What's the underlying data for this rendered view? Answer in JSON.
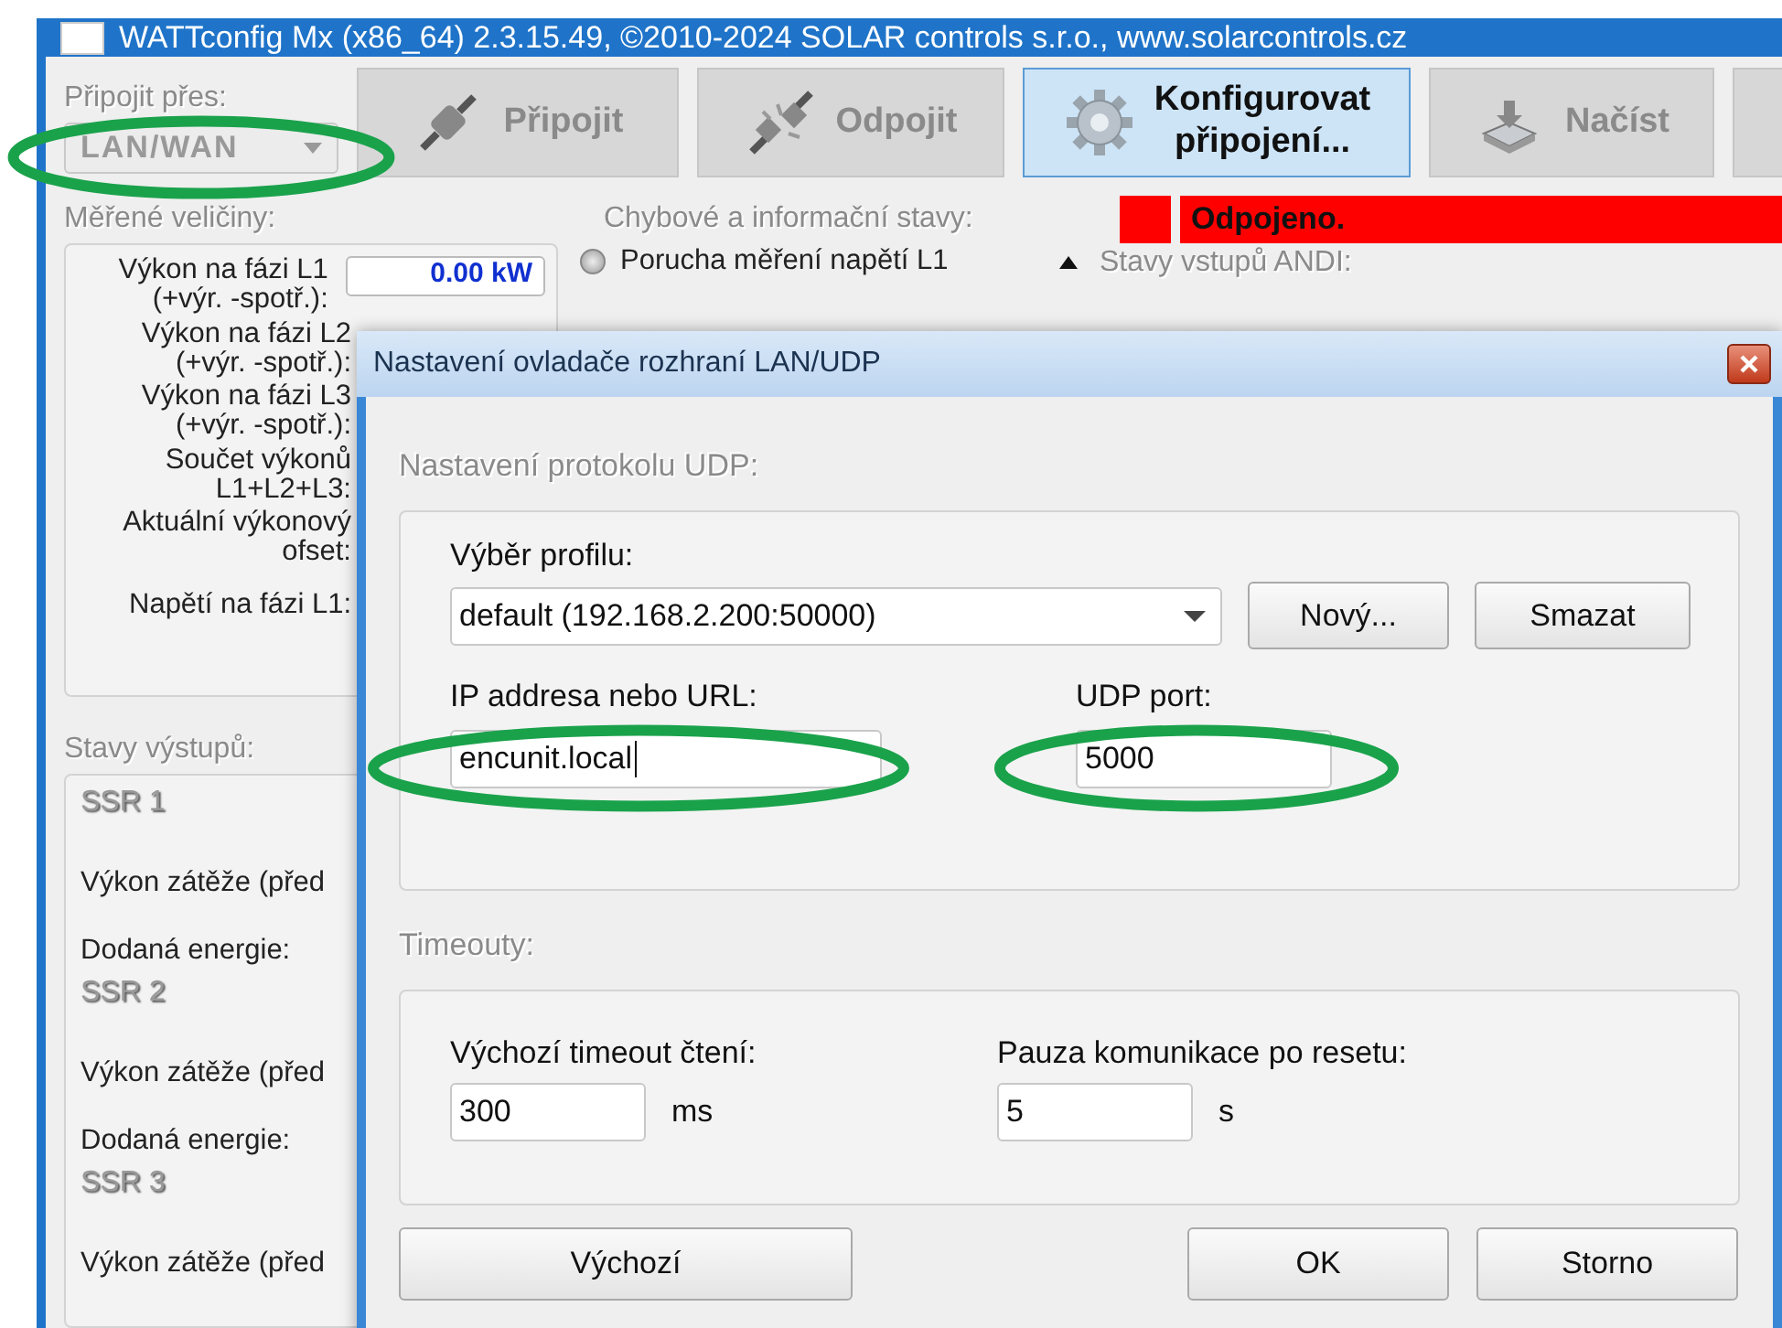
{
  "window": {
    "title": "WATTconfig Mx (x86_64) 2.3.15.49, ©2010-2024 SOLAR controls s.r.o., www.solarcontrols.cz"
  },
  "connection": {
    "label": "Připojit přes:",
    "value": "LAN/WAN",
    "disabled": true,
    "circled": true
  },
  "toolbar": [
    {
      "kind": "plug",
      "label": "Připojit",
      "selected": false
    },
    {
      "kind": "unplug",
      "label": "Odpojit",
      "selected": false
    },
    {
      "kind": "gear",
      "label": "Konfigurovat připojení...",
      "selected": true
    },
    {
      "kind": "load",
      "label": "Načíst",
      "selected": false
    },
    {
      "kind": "partial",
      "selected": false
    }
  ],
  "measured": {
    "title": "Měřené veličiny:",
    "rows": [
      {
        "label": "Výkon na fázi L1\n(+výr. -spotř.):",
        "value": "0.00 kW"
      },
      {
        "label": "Výkon na fázi L2\n(+výr. -spotř.):"
      },
      {
        "label": "Výkon na fázi L3\n(+výr. -spotř.):"
      },
      {
        "label": "Součet výkonů\nL1+L2+L3:"
      },
      {
        "label": "Aktuální výkonový\nofset:"
      },
      {
        "label": "Napětí na fázi L1:"
      }
    ]
  },
  "errors": {
    "title": "Chybové a informační stavy:",
    "items": [
      {
        "label": "Porucha měření napětí L1",
        "on": false
      }
    ]
  },
  "status": {
    "text": "Odpojeno."
  },
  "andi": {
    "title": "Stavy vstupů ANDI:"
  },
  "outputs": {
    "title": "Stavy výstupů:",
    "groups": [
      {
        "name": "SSR 1",
        "rows": [
          "Výkon zátěže (před",
          "Dodaná energie:"
        ]
      },
      {
        "name": "SSR 2",
        "rows": [
          "Výkon zátěže (před",
          "Dodaná energie:"
        ]
      },
      {
        "name": "SSR 3",
        "rows": [
          "Výkon zátěže (před"
        ]
      }
    ]
  },
  "dialog": {
    "title": "Nastavení ovladače rozhraní LAN/UDP",
    "udp": {
      "title": "Nastavení protokolu UDP:",
      "profile_label": "Výběr profilu:",
      "profile_value": "default (192.168.2.200:50000)",
      "buttons": [
        "Nový...",
        "Smazat"
      ],
      "ip_label": "IP addresa nebo URL:",
      "ip_value": "encunit.local",
      "ip_circled": true,
      "port_label": "UDP port:",
      "port_value": "5000",
      "port_circled": true
    },
    "timeouts": {
      "title": "Timeouty:",
      "read_label": "Výchozí timeout čtení:",
      "read_value": "300",
      "read_unit": "ms",
      "pause_label": "Pauza komunikace po resetu:",
      "pause_value": "5",
      "pause_unit": "s"
    },
    "buttons": [
      "Výchozí",
      "OK",
      "Storno"
    ]
  }
}
